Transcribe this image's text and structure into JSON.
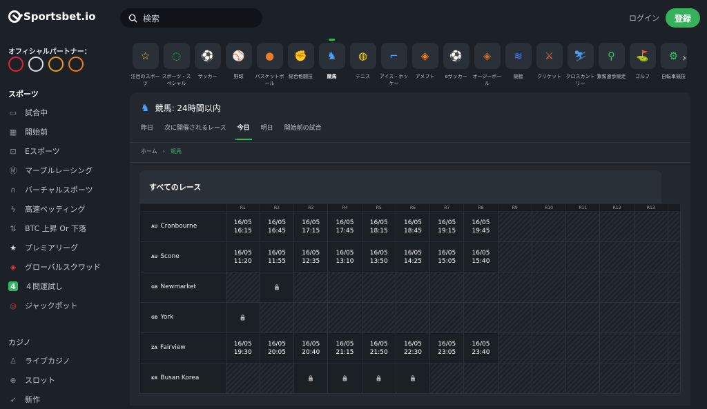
{
  "header": {
    "brand": "Sportsbet.io",
    "search_placeholder": "検索",
    "login": "ログイン",
    "register": "登録"
  },
  "sidebar": {
    "partners_title": "オフィシャルパートナー：",
    "partners": [
      {
        "icon": "laliga-logo-icon",
        "color": "#e0243a"
      },
      {
        "icon": "newcastle-logo-icon",
        "color": "#dddddd"
      },
      {
        "icon": "hull-city-logo-icon",
        "color": "#f29a1e"
      },
      {
        "icon": "basketball-logo-icon",
        "color": "#f07a22"
      }
    ],
    "sports_title": "スポーツ",
    "sports": [
      {
        "label": "試合中",
        "icon": "monitor-icon",
        "glyph": "▭"
      },
      {
        "label": "開始前",
        "icon": "calendar-icon",
        "glyph": "▦"
      },
      {
        "label": "Eスポーツ",
        "icon": "gamepad-icon",
        "glyph": "⊡"
      },
      {
        "label": "マーブルレーシング",
        "icon": "marble-icon",
        "glyph": "Ⓜ"
      },
      {
        "label": "バーチャルスポーツ",
        "icon": "headset-icon",
        "glyph": "∩"
      },
      {
        "label": "高速ベッティング",
        "icon": "lightning-icon",
        "glyph": "ϟ"
      },
      {
        "label": "BTC 上昇 Or 下落",
        "icon": "arrows-icon",
        "glyph": "⇅"
      },
      {
        "label": "プレミアリーグ",
        "icon": "star-icon",
        "glyph": "★"
      },
      {
        "label": "グローバルスクワッド",
        "icon": "squad-icon",
        "glyph": "◈"
      },
      {
        "label": "４問運試し",
        "icon": "four-icon",
        "glyph": "4"
      },
      {
        "label": "ジャックポット",
        "icon": "jackpot-icon",
        "glyph": "◎"
      }
    ],
    "casino_title": "カジノ",
    "casino": [
      {
        "label": "ライブカジノ",
        "icon": "dealer-icon",
        "glyph": "♙"
      },
      {
        "label": "スロット",
        "icon": "slot-icon",
        "glyph": "⊕"
      },
      {
        "label": "新作",
        "icon": "rocket-icon",
        "glyph": "➶"
      }
    ]
  },
  "categories": [
    {
      "label": "注目のスポーツ",
      "icon": "star-icon",
      "glyph": "☆",
      "color": "#f2c230"
    },
    {
      "label": "スポーツ・スペシャル",
      "icon": "special-icon",
      "glyph": "◌",
      "color": "#3cc06e"
    },
    {
      "label": "サッカー",
      "icon": "soccer-icon",
      "glyph": "⚽",
      "color": "#e33b3b"
    },
    {
      "label": "野球",
      "icon": "baseball-icon",
      "glyph": "⚾",
      "color": "#e05050"
    },
    {
      "label": "バスケットボール",
      "icon": "basketball-icon",
      "glyph": "●",
      "color": "#f07a22"
    },
    {
      "label": "総合格闘技",
      "icon": "glove-icon",
      "glyph": "✊",
      "color": "#d8dde2"
    },
    {
      "label": "競馬",
      "icon": "horse-racing-icon",
      "glyph": "♞",
      "color": "#4aa3ff"
    },
    {
      "label": "テニス",
      "icon": "tennis-icon",
      "glyph": "◍",
      "color": "#e6d02a"
    },
    {
      "label": "アイス・ホッケー",
      "icon": "hockey-icon",
      "glyph": "⌐",
      "color": "#4aa3ff"
    },
    {
      "label": "アメフト",
      "icon": "football-icon",
      "glyph": "◈",
      "color": "#f07a22"
    },
    {
      "label": "eサッカー",
      "icon": "esoccer-icon",
      "glyph": "⚽",
      "color": "#e33b3b"
    },
    {
      "label": "オージーボール",
      "icon": "aussie-ball-icon",
      "glyph": "◈",
      "color": "#c06a30"
    },
    {
      "label": "競艇",
      "icon": "boat-icon",
      "glyph": "≋",
      "color": "#4a7dff"
    },
    {
      "label": "クリケット",
      "icon": "cricket-icon",
      "glyph": "⚔",
      "color": "#e07050"
    },
    {
      "label": "クロスカントリー",
      "icon": "skiing-icon",
      "glyph": "⛷",
      "color": "#4aa3ff"
    },
    {
      "label": "繋駕速歩競走",
      "icon": "harness-icon",
      "glyph": "⚲",
      "color": "#3cc06e"
    },
    {
      "label": "ゴルフ",
      "icon": "golf-icon",
      "glyph": "⛳",
      "color": "#3cc06e"
    },
    {
      "label": "自転車競技",
      "icon": "cycling-icon",
      "glyph": "⚙",
      "color": "#3cc06e"
    }
  ],
  "active_category": "競馬",
  "panel": {
    "title": "競馬: 24時間以内",
    "tabs": [
      "昨日",
      "次に開催されるレース",
      "今日",
      "明日",
      "開始前の試合"
    ],
    "active_tab": "今日",
    "breadcrumb": [
      "ホーム",
      "競馬"
    ],
    "races_title": "すべてのレース",
    "columns": [
      "R1",
      "R2",
      "R3",
      "R4",
      "R5",
      "R6",
      "R7",
      "R8",
      "R9",
      "R10",
      "R11",
      "R12",
      "R13",
      ""
    ],
    "rows": [
      {
        "cc": "AU",
        "venue": "Cranbourne",
        "cells": [
          "16/05 16:15",
          "16/05 16:45",
          "16/05 17:15",
          "16/05 17:45",
          "16/05 18:15",
          "16/05 18:45",
          "16/05 19:15",
          "16/05 19:45",
          "",
          "",
          "",
          "",
          "",
          ""
        ]
      },
      {
        "cc": "AU",
        "venue": "Scone",
        "cells": [
          "16/05 11:20",
          "16/05 11:55",
          "16/05 12:35",
          "16/05 13:10",
          "16/05 13:50",
          "16/05 14:25",
          "16/05 15:05",
          "16/05 15:40",
          "",
          "",
          "",
          "",
          "",
          ""
        ]
      },
      {
        "cc": "GB",
        "venue": "Newmarket",
        "cells": [
          "",
          "lock",
          "",
          "",
          "",
          "",
          "",
          "",
          "",
          "",
          "",
          "",
          "",
          ""
        ]
      },
      {
        "cc": "GB",
        "venue": "York",
        "cells": [
          "lock",
          "",
          "",
          "",
          "",
          "",
          "",
          "",
          "",
          "",
          "",
          "",
          "",
          ""
        ]
      },
      {
        "cc": "ZA",
        "venue": "Fairview",
        "cells": [
          "16/05 19:30",
          "16/05 20:05",
          "16/05 20:40",
          "16/05 21:15",
          "16/05 21:50",
          "16/05 22:30",
          "16/05 23:05",
          "16/05 23:40",
          "",
          "",
          "",
          "",
          "",
          ""
        ]
      },
      {
        "cc": "KR",
        "venue": "Busan Korea",
        "cells": [
          "",
          "",
          "lock",
          "lock",
          "lock",
          "lock",
          "",
          "",
          "",
          "",
          "",
          "",
          "",
          ""
        ]
      }
    ]
  }
}
